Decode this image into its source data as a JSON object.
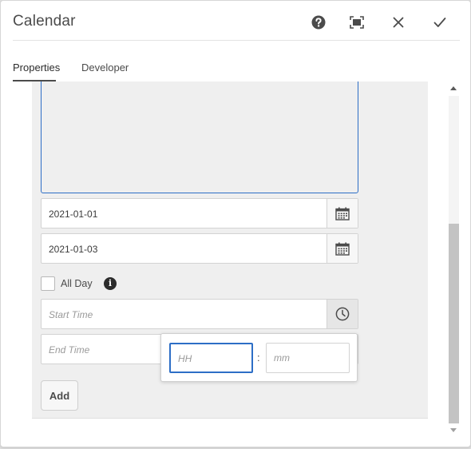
{
  "dialog": {
    "title": "Calendar",
    "actions": [
      "help-icon",
      "fullscreen-icon",
      "close-icon",
      "checkmark-icon"
    ]
  },
  "tabs": [
    {
      "label": "Properties",
      "active": true
    },
    {
      "label": "Developer",
      "active": false
    }
  ],
  "form": {
    "start_date": {
      "value": "2021-01-01",
      "icon": "calendar-icon"
    },
    "end_date": {
      "value": "2021-01-03",
      "icon": "calendar-icon"
    },
    "all_day": {
      "label": "All Day",
      "checked": false,
      "info_icon": "info-icon"
    },
    "start_time": {
      "placeholder": "Start Time",
      "icon": "clock-icon"
    },
    "end_time": {
      "placeholder": "End Time"
    },
    "add_button": "Add"
  },
  "time_picker": {
    "hours_placeholder": "HH",
    "separator": ":",
    "minutes_placeholder": "mm"
  },
  "colors": {
    "focus": "#2d6ec6",
    "panel_bg": "#efefef"
  }
}
